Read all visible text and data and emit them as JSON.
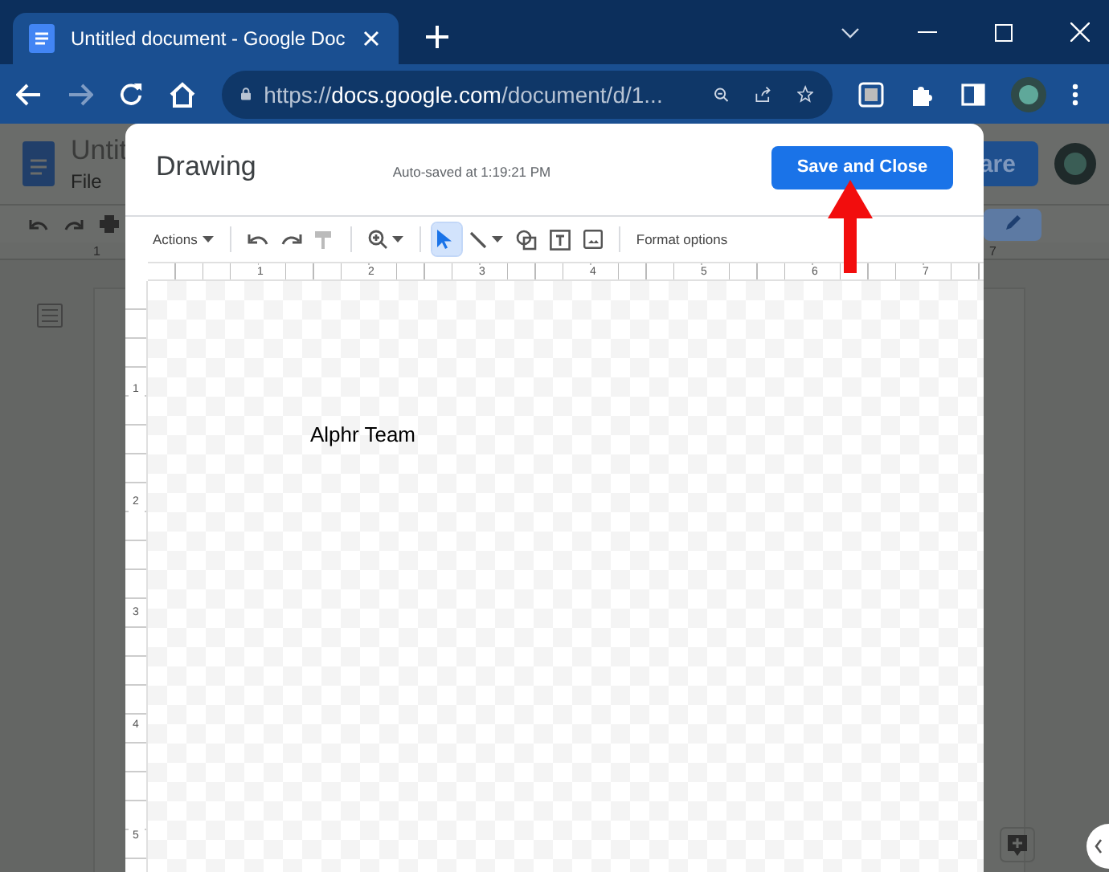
{
  "browser": {
    "tab_title": "Untitled document - Google Doc",
    "url_scheme": "https://",
    "url_host": "docs.google.com",
    "url_path": "/document/d/1..."
  },
  "docs_background": {
    "title": "Untit",
    "menu": [
      "File"
    ],
    "share_button": "are",
    "ruler_label": "1",
    "right_ruler_label": "7"
  },
  "dialog": {
    "title": "Drawing",
    "autosave": "Auto-saved at 1:19:21 PM",
    "save_button": "Save and Close",
    "toolbar": [
      {
        "kind": "menu",
        "label": "Actions",
        "selected": false
      },
      {
        "kind": "divider"
      },
      {
        "kind": "undo",
        "selected": false
      },
      {
        "kind": "redo",
        "selected": false
      },
      {
        "kind": "paint",
        "selected": false
      },
      {
        "kind": "divider"
      },
      {
        "kind": "zoom",
        "selected": false
      },
      {
        "kind": "divider"
      },
      {
        "kind": "select",
        "selected": true
      },
      {
        "kind": "line",
        "selected": false
      },
      {
        "kind": "shape",
        "selected": false
      },
      {
        "kind": "textbox",
        "selected": false
      },
      {
        "kind": "image",
        "selected": false
      },
      {
        "kind": "divider"
      },
      {
        "kind": "text",
        "label": "Format options",
        "selected": false
      }
    ],
    "horizontal_ruler": [
      "1",
      "2",
      "3",
      "4",
      "5",
      "6",
      "7"
    ],
    "vertical_ruler": [
      "1",
      "2",
      "3",
      "4",
      "5"
    ],
    "canvas_text": "Alphr Team"
  }
}
